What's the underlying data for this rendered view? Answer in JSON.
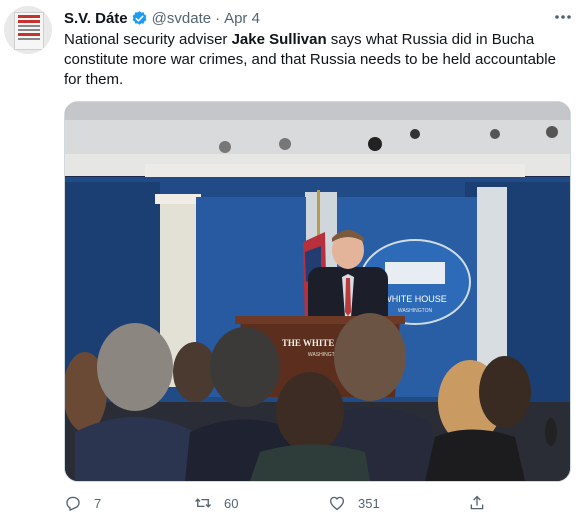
{
  "tweet": {
    "author_name": "S.V. Dáte",
    "handle": "@svdate",
    "separator": "·",
    "date": "Apr 4",
    "text_before": "National security adviser ",
    "text_bold": "Jake Sullivan",
    "text_after": " says what Russia did in Bucha constitute more war crimes, and that Russia needs to be held accountable for them."
  },
  "avatar": {
    "sign_top": "ESSPEE IDIOT",
    "sign_bottom": "S.V. DATE"
  },
  "media": {
    "podium_label": "THE WHITE HOUSE",
    "podium_sub": "WASHINGTON",
    "seal_label": "WHITE HOUSE",
    "seal_sub": "WASHINGTON"
  },
  "actions": {
    "replies": "7",
    "retweets": "60",
    "likes": "351"
  },
  "colors": {
    "accent": "#1d9bf0",
    "muted": "#536471",
    "briefing_blue": "#1f4f8f"
  }
}
